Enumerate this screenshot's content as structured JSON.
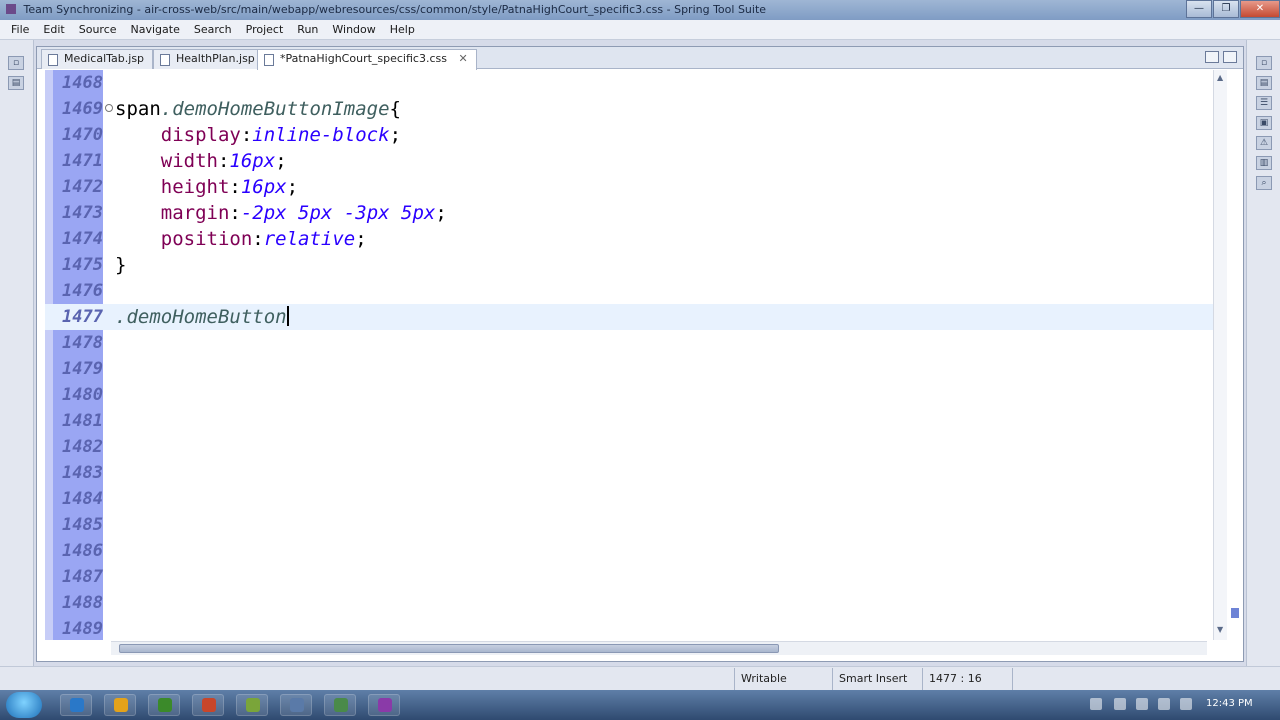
{
  "window": {
    "title": "Team Synchronizing - air-cross-web/src/main/webapp/webresources/css/common/style/PatnaHighCourt_specific3.css - Spring Tool Suite",
    "controls": [
      "—",
      "❐",
      "✕"
    ]
  },
  "menu": [
    "File",
    "Edit",
    "Source",
    "Navigate",
    "Search",
    "Project",
    "Run",
    "Window",
    "Help"
  ],
  "tabs": [
    {
      "label": "MedicalTab.jsp",
      "active": false
    },
    {
      "label": "HealthPlan.jsp",
      "active": false
    },
    {
      "label": "*PatnaHighCourt_specific3.css",
      "active": true
    }
  ],
  "editor": {
    "lines": [
      {
        "num": "1468",
        "tokens": []
      },
      {
        "num": "1469",
        "fold": true,
        "tokens": [
          {
            "t": "span",
            "c": "sel"
          },
          {
            "t": ".demoHomeButtonImage",
            "c": "cls"
          },
          {
            "t": "{",
            "c": "sel"
          }
        ]
      },
      {
        "num": "1470",
        "tokens": [
          {
            "t": "    ",
            "c": "sel"
          },
          {
            "t": "display",
            "c": "prop"
          },
          {
            "t": ":",
            "c": "sel"
          },
          {
            "t": "inline-block",
            "c": "val"
          },
          {
            "t": ";",
            "c": "sel"
          }
        ]
      },
      {
        "num": "1471",
        "tokens": [
          {
            "t": "    ",
            "c": "sel"
          },
          {
            "t": "width",
            "c": "prop"
          },
          {
            "t": ":",
            "c": "sel"
          },
          {
            "t": "16px",
            "c": "val"
          },
          {
            "t": ";",
            "c": "sel"
          }
        ]
      },
      {
        "num": "1472",
        "tokens": [
          {
            "t": "    ",
            "c": "sel"
          },
          {
            "t": "height",
            "c": "prop"
          },
          {
            "t": ":",
            "c": "sel"
          },
          {
            "t": "16px",
            "c": "val"
          },
          {
            "t": ";",
            "c": "sel"
          }
        ]
      },
      {
        "num": "1473",
        "tokens": [
          {
            "t": "    ",
            "c": "sel"
          },
          {
            "t": "margin",
            "c": "prop"
          },
          {
            "t": ":",
            "c": "sel"
          },
          {
            "t": "-2px 5px -3px 5px",
            "c": "val"
          },
          {
            "t": ";",
            "c": "sel"
          }
        ]
      },
      {
        "num": "1474",
        "tokens": [
          {
            "t": "    ",
            "c": "sel"
          },
          {
            "t": "position",
            "c": "prop"
          },
          {
            "t": ":",
            "c": "sel"
          },
          {
            "t": "relative",
            "c": "val"
          },
          {
            "t": ";",
            "c": "sel"
          }
        ]
      },
      {
        "num": "1475",
        "tokens": [
          {
            "t": "}",
            "c": "sel"
          }
        ]
      },
      {
        "num": "1476",
        "tokens": []
      },
      {
        "num": "1477",
        "current": true,
        "caret": true,
        "tokens": [
          {
            "t": ".demoHomeButton",
            "c": "cls"
          }
        ]
      },
      {
        "num": "1478",
        "tokens": []
      },
      {
        "num": "1479",
        "tokens": []
      },
      {
        "num": "1480",
        "tokens": []
      },
      {
        "num": "1481",
        "tokens": []
      },
      {
        "num": "1482",
        "tokens": []
      },
      {
        "num": "1483",
        "tokens": []
      },
      {
        "num": "1484",
        "tokens": []
      },
      {
        "num": "1485",
        "tokens": []
      },
      {
        "num": "1486",
        "tokens": []
      },
      {
        "num": "1487",
        "tokens": []
      },
      {
        "num": "1488",
        "tokens": []
      },
      {
        "num": "1489",
        "tokens": []
      }
    ]
  },
  "status": {
    "writable": "Writable",
    "insert_mode": "Smart Insert",
    "position": "1477 : 16"
  },
  "taskbar": {
    "clock": "12:43 PM",
    "app_colors": [
      "#2a78c8",
      "#e3a21a",
      "#3b8a2a",
      "#c8462a",
      "#7aa53a",
      "#5a7aa8",
      "#4a8a4a",
      "#8a3aa8"
    ]
  }
}
